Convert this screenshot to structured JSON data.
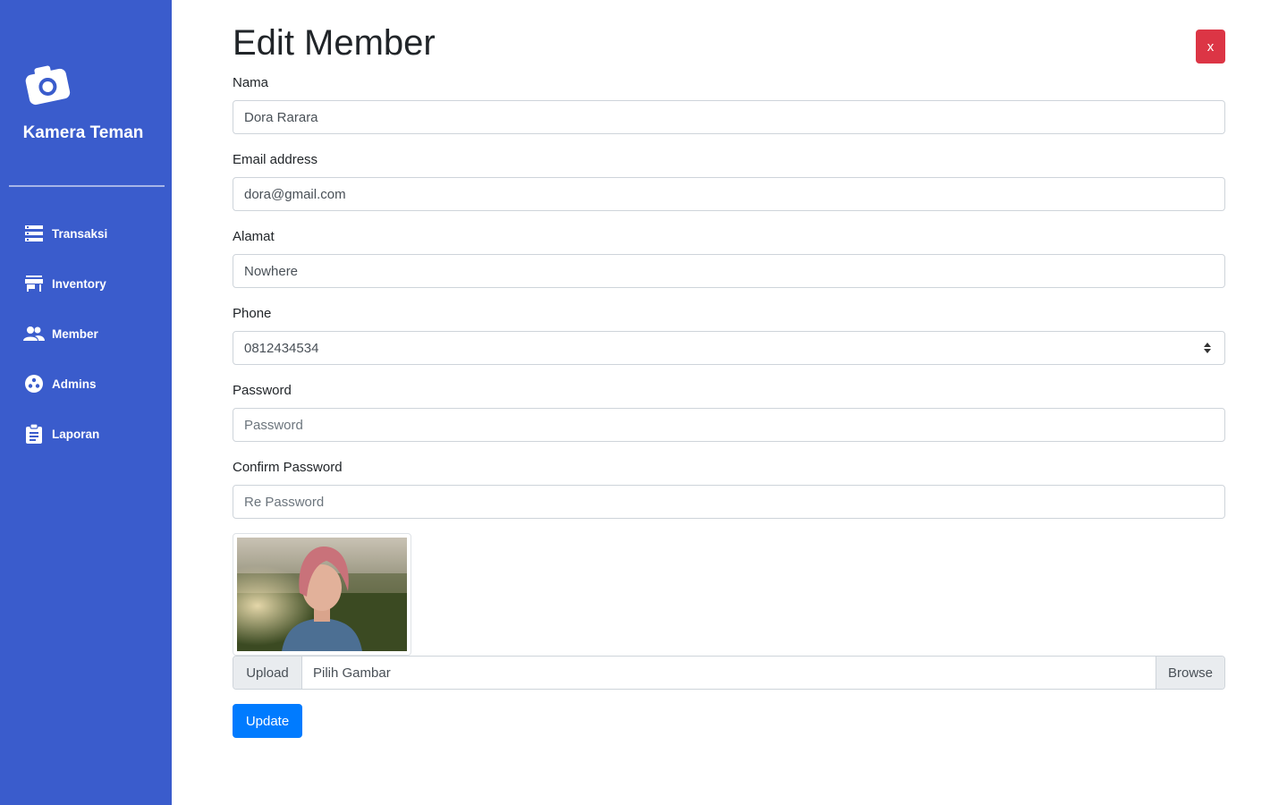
{
  "sidebar": {
    "brand": "Kamera Teman",
    "brand_icon": "camera-icon",
    "items": [
      {
        "label": "Transaksi",
        "icon": "storage-icon"
      },
      {
        "label": "Inventory",
        "icon": "store-icon"
      },
      {
        "label": "Member",
        "icon": "people-icon"
      },
      {
        "label": "Admins",
        "icon": "group-work-icon"
      },
      {
        "label": "Laporan",
        "icon": "clipboard-icon"
      }
    ],
    "background": "#3a5ccc"
  },
  "page": {
    "title": "Edit Member",
    "close_label": "x"
  },
  "form": {
    "nama_label": "Nama",
    "nama_value": "Dora Rarara",
    "email_label": "Email address",
    "email_value": "dora@gmail.com",
    "alamat_label": "Alamat",
    "alamat_value": "Nowhere",
    "phone_label": "Phone",
    "phone_value": "0812434534",
    "password_label": "Password",
    "password_placeholder": "Password",
    "confirm_label": "Confirm Password",
    "confirm_placeholder": "Re Password",
    "upload_prefix": "Upload",
    "upload_file": "Pilih Gambar",
    "upload_browse": "Browse",
    "submit_label": "Update"
  },
  "colors": {
    "primary": "#007bff",
    "danger": "#dc3545"
  }
}
